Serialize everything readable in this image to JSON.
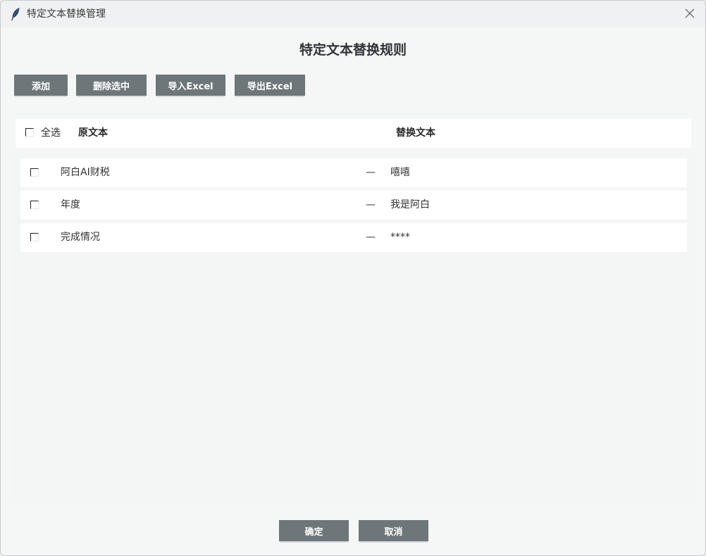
{
  "window": {
    "title": "特定文本替换管理",
    "icon": "feather-icon",
    "close_icon": "close-icon"
  },
  "heading": "特定文本替换规则",
  "toolbar": {
    "add": "添加",
    "delete_selected": "删除选中",
    "import_excel": "导入Excel",
    "export_excel": "导出Excel"
  },
  "table": {
    "select_all_label": "全选",
    "select_all_checked": false,
    "col_original": "原文本",
    "col_replacement": "替换文本",
    "rows": [
      {
        "checked": false,
        "original": "阿白AI财税",
        "separator": "—",
        "replacement": "嘻嘻"
      },
      {
        "checked": false,
        "original": "年度",
        "separator": "—",
        "replacement": "我是阿白"
      },
      {
        "checked": false,
        "original": "完成情况",
        "separator": "—",
        "replacement": "****"
      }
    ]
  },
  "footer": {
    "ok": "确定",
    "cancel": "取消"
  },
  "colors": {
    "button_bg": "#6d7679",
    "button_text": "#ffffff",
    "window_bg": "#f3f4f4"
  }
}
